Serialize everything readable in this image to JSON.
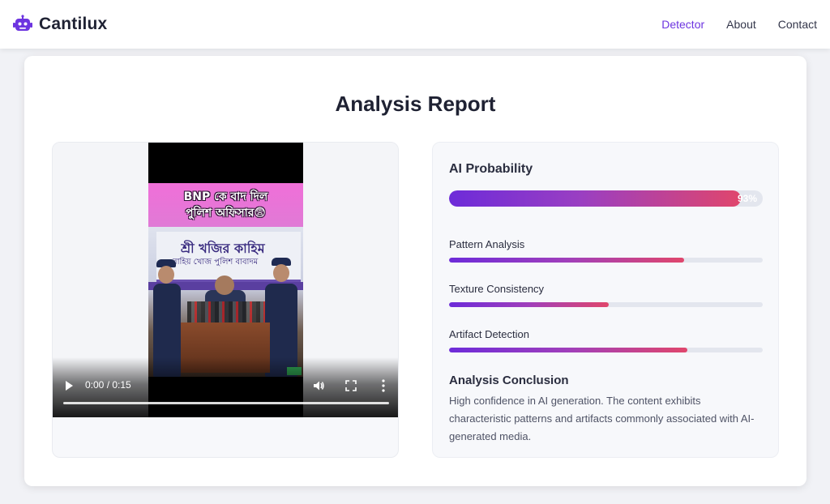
{
  "navbar": {
    "brand_name": "Cantilux",
    "brand_icon": "robot-icon",
    "links": [
      {
        "label": "Detector",
        "active": true
      },
      {
        "label": "About",
        "active": false
      },
      {
        "label": "Contact",
        "active": false
      }
    ]
  },
  "page": {
    "title": "Analysis Report"
  },
  "video": {
    "overlay_line1": "BNP কে বাদ দিল",
    "overlay_line2": "পুলিশ অফিসার😨",
    "backdrop_line1": "শ্রী খজির কাহিম",
    "backdrop_line2": "বাহিয় খোজ পুলিশ বাবাদম",
    "time": "0:00 / 0:15",
    "progress_fraction": 0.0
  },
  "analysis": {
    "ai_probability_label": "AI Probability",
    "ai_probability_value": "93%",
    "ai_probability_fraction": 0.93,
    "metrics": [
      {
        "label": "Pattern Analysis",
        "fraction": 0.75
      },
      {
        "label": "Texture Consistency",
        "fraction": 0.51
      },
      {
        "label": "Artifact Detection",
        "fraction": 0.76
      }
    ],
    "conclusion_title": "Analysis Conclusion",
    "conclusion_text": "High confidence in AI generation. The content exhibits characteristic patterns and artifacts commonly associated with AI-generated media."
  },
  "colors": {
    "accent": "#6d35e0",
    "gradient_start": "#6d2bd9",
    "gradient_end": "#e0466c"
  }
}
